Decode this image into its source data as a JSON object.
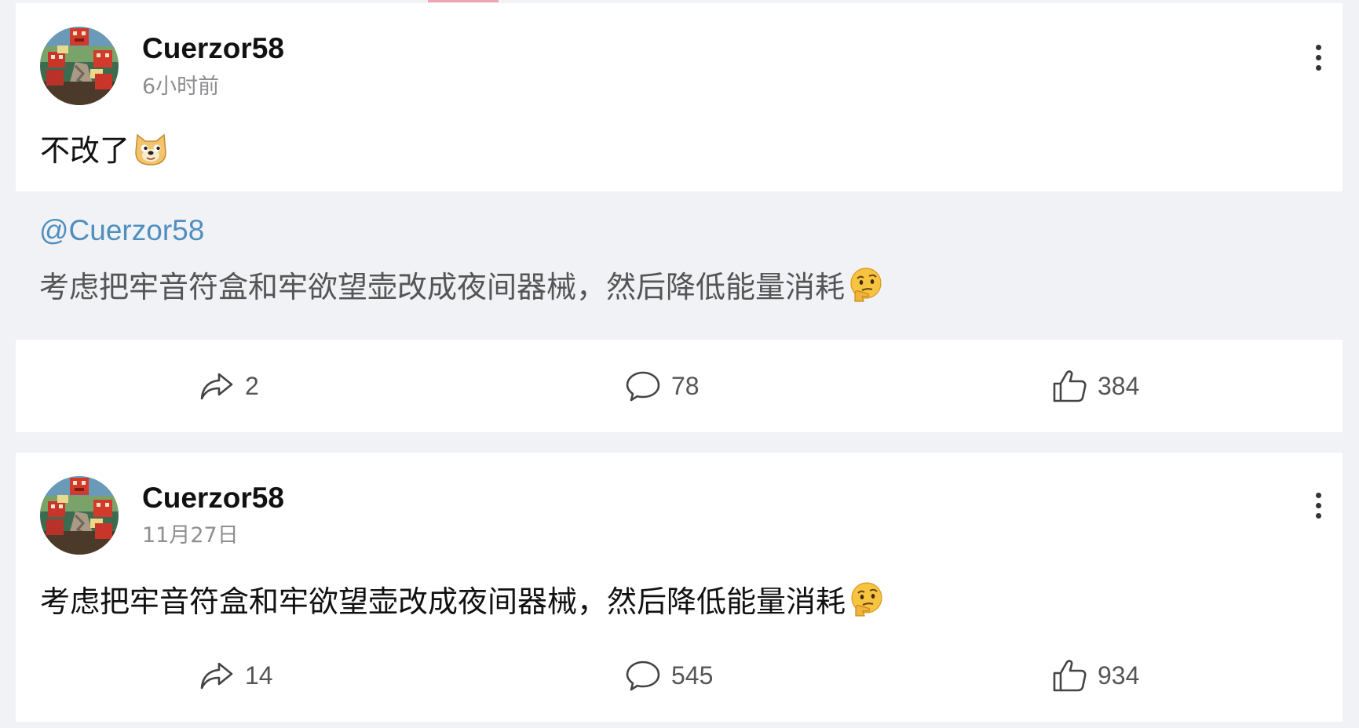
{
  "posts": [
    {
      "author": "Cuerzor58",
      "time": "6小时前",
      "text": "不改了",
      "emoji": "doge-emoji",
      "repost": {
        "mention": "@Cuerzor58",
        "text": "考虑把牢音符盒和牢欲望壶改成夜间器械，然后降低能量消耗",
        "emoji": "thinking-emoji"
      },
      "actions": {
        "share_count": "2",
        "comment_count": "78",
        "like_count": "384"
      }
    },
    {
      "author": "Cuerzor58",
      "time": "11月27日",
      "text": "考虑把牢音符盒和牢欲望壶改成夜间器械，然后降低能量消耗",
      "emoji": "thinking-emoji",
      "actions": {
        "share_count": "14",
        "comment_count": "545",
        "like_count": "934"
      }
    }
  ],
  "icons": {
    "share": "share-icon",
    "comment": "comment-icon",
    "like": "like-icon",
    "more": "more-vertical-icon"
  },
  "colors": {
    "background": "#f1f2f5",
    "card": "#ffffff",
    "mention": "#4f8fbf",
    "secondary_text": "#8e8e93",
    "accent": "#f3a2b3"
  }
}
